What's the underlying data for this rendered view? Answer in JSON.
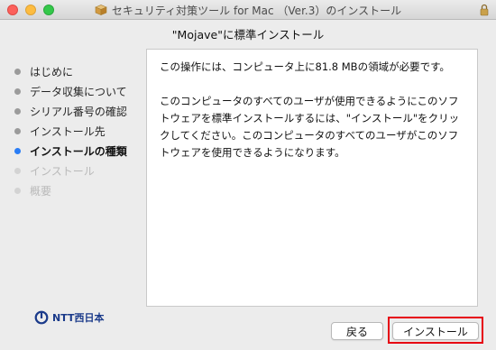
{
  "window": {
    "title": "セキュリティ対策ツール for Mac （Ver.3）のインストール",
    "icons": {
      "title_icon": "package-icon",
      "lock": "lock-icon"
    }
  },
  "subtitle": "\"Mojave\"に標準インストール",
  "steps": [
    {
      "label": "はじめに",
      "state": "done"
    },
    {
      "label": "データ収集について",
      "state": "done"
    },
    {
      "label": "シリアル番号の確認",
      "state": "done"
    },
    {
      "label": "インストール先",
      "state": "done"
    },
    {
      "label": "インストールの種類",
      "state": "active"
    },
    {
      "label": "インストール",
      "state": "future"
    },
    {
      "label": "概要",
      "state": "future"
    }
  ],
  "content": {
    "para1": "この操作には、コンピュータ上に81.8 MBの領域が必要です。",
    "para2": "このコンピュータのすべてのユーザが使用できるようにこのソフトウェアを標準インストールするには、\"インストール\"をクリックしてください。このコンピュータのすべてのユーザがこのソフトウェアを使用できるようになります。"
  },
  "logo": {
    "text": "NTT西日本",
    "icon": "ntt-logo-icon"
  },
  "buttons": {
    "back": "戻る",
    "install": "インストール"
  },
  "colors": {
    "active_step_dot": "#2a7df5",
    "highlight": "#e60012",
    "logo": "#1a3a8a"
  }
}
